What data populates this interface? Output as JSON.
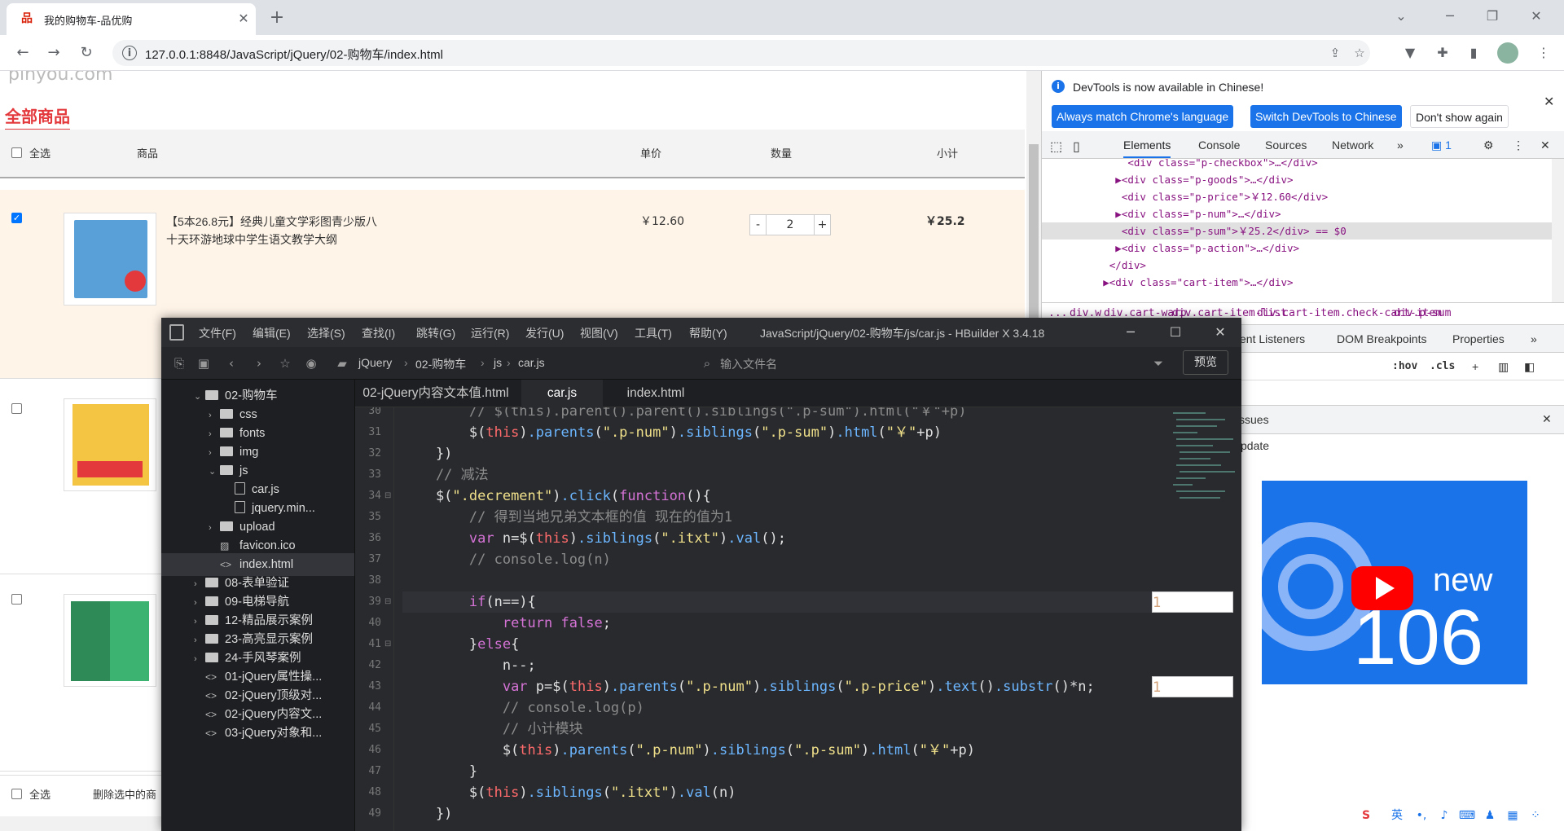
{
  "browser": {
    "tab_title": "我的购物车-品优购",
    "tab_favicon": "cart-icon",
    "url": "127.0.0.1:8848/JavaScript/jQuery/02-购物车/index.html"
  },
  "page": {
    "logo_fragment": "pinyou.com",
    "all_goods": "全部商品",
    "header": {
      "select_all": "全选",
      "goods": "商品",
      "unit_price": "单价",
      "quantity": "数量",
      "subtotal": "小计"
    },
    "items": [
      {
        "title": "【5本26.8元】经典儿童文学彩图青少版八十天环游地球中学生语文教学大纲",
        "price": "￥12.60",
        "qty": "2",
        "sum": "￥25.2",
        "checked": true
      },
      {
        "title": "",
        "price": "",
        "qty": "",
        "sum": "",
        "checked": false
      },
      {
        "title": "",
        "price": "",
        "qty": "",
        "sum": "",
        "checked": false
      }
    ],
    "qty_minus": "-",
    "qty_plus": "+",
    "footer": {
      "select_all": "全选",
      "delete_selected": "删除选中的商"
    }
  },
  "devtools": {
    "banner_msg": "DevTools is now available in Chinese!",
    "btn_match": "Always match Chrome's language",
    "btn_switch": "Switch DevTools to Chinese",
    "btn_dont": "Don't show again",
    "tabs": [
      "Elements",
      "Console",
      "Sources",
      "Network"
    ],
    "issues_count": "1",
    "dom_lines": [
      {
        "pre": "      <div class=\"p-checkbox\">…</div>",
        "sel": false
      },
      {
        "pre": "    ▶<div class=\"p-goods\">…</div>",
        "sel": false
      },
      {
        "pre": "     <div class=\"p-price\">￥12.60</div>",
        "sel": false
      },
      {
        "pre": "    ▶<div class=\"p-num\">…</div>",
        "sel": false
      },
      {
        "pre": "     <div class=\"p-sum\">￥25.2</div> == $0",
        "sel": true
      },
      {
        "pre": "    ▶<div class=\"p-action\">…</div>",
        "sel": false
      },
      {
        "pre": "   </div>",
        "sel": false
      },
      {
        "pre": "  ▶<div class=\"cart-item\">…</div>",
        "sel": false
      }
    ],
    "crumbs": [
      "div.w",
      "div.cart-warp",
      "div.cart-item-list",
      "div.cart-item.check-cart-item",
      "div.p-sum"
    ],
    "subtabs": [
      "vent Listeners",
      "DOM Breakpoints",
      "Properties"
    ],
    "filter_hov": ":hov",
    "filter_cls": ".cls",
    "issues_label": "ssues",
    "update_label": "pdate",
    "promo_new": "new",
    "promo_num": "106"
  },
  "hbuilder": {
    "menu": [
      "文件(F)",
      "编辑(E)",
      "选择(S)",
      "查找(I)",
      "跳转(G)",
      "运行(R)",
      "发行(U)",
      "视图(V)",
      "工具(T)",
      "帮助(Y)"
    ],
    "window_title": "JavaScript/jQuery/02-购物车/js/car.js - HBuilder X 3.4.18",
    "path": [
      "jQuery",
      "02-购物车",
      "js",
      "car.js"
    ],
    "search_placeholder": "输入文件名",
    "preview": "预览",
    "tree": [
      {
        "label": "02-购物车",
        "type": "folder-open",
        "indent": 40
      },
      {
        "label": "css",
        "type": "folder",
        "indent": 58
      },
      {
        "label": "fonts",
        "type": "folder",
        "indent": 58
      },
      {
        "label": "img",
        "type": "folder",
        "indent": 58
      },
      {
        "label": "js",
        "type": "folder-open",
        "indent": 58
      },
      {
        "label": "car.js",
        "type": "file",
        "indent": 90
      },
      {
        "label": "jquery.min...",
        "type": "file",
        "indent": 90
      },
      {
        "label": "upload",
        "type": "folder",
        "indent": 58
      },
      {
        "label": "favicon.ico",
        "type": "image",
        "indent": 72
      },
      {
        "label": "index.html",
        "type": "code",
        "indent": 72,
        "sel": true
      },
      {
        "label": "08-表单验证",
        "type": "folder",
        "indent": 40
      },
      {
        "label": "09-电梯导航",
        "type": "folder",
        "indent": 40
      },
      {
        "label": "12-精品展示案例",
        "type": "folder",
        "indent": 40
      },
      {
        "label": "23-高亮显示案例",
        "type": "folder",
        "indent": 40
      },
      {
        "label": "24-手风琴案例",
        "type": "folder",
        "indent": 40
      },
      {
        "label": "01-jQuery属性操...",
        "type": "code",
        "indent": 54
      },
      {
        "label": "02-jQuery顶级对...",
        "type": "code",
        "indent": 54
      },
      {
        "label": "02-jQuery内容文...",
        "type": "code",
        "indent": 54
      },
      {
        "label": "03-jQuery对象和...",
        "type": "code",
        "indent": 54
      }
    ],
    "tabs": [
      "02-jQuery内容文本值.html",
      "car.js",
      "index.html"
    ],
    "code_lines": [
      {
        "n": "30",
        "text": "        // $(this).parent().parent().siblings(\".p-sum\").html(\"￥\"+p)"
      },
      {
        "n": "31",
        "text": "        $(this).parents(\".p-num\").siblings(\".p-sum\").html(\"￥\"+p)"
      },
      {
        "n": "32",
        "text": "    })"
      },
      {
        "n": "33",
        "text": "    // 减法"
      },
      {
        "n": "34",
        "text": "    $(\".decrement\").click(function(){"
      },
      {
        "n": "35",
        "text": "        // 得到当地兄弟文本框的值 现在的值为1"
      },
      {
        "n": "36",
        "text": "        var n=$(this).siblings(\".itxt\").val();"
      },
      {
        "n": "37",
        "text": "        // console.log(n)"
      },
      {
        "n": "38",
        "text": ""
      },
      {
        "n": "39",
        "text": "        if(n==1){"
      },
      {
        "n": "40",
        "text": "            return false;"
      },
      {
        "n": "41",
        "text": "        }else{"
      },
      {
        "n": "42",
        "text": "            n--;"
      },
      {
        "n": "43",
        "text": "            var p=$(this).parents(\".p-num\").siblings(\".p-price\").text().substr(1)*n;"
      },
      {
        "n": "44",
        "text": "            // console.log(p)"
      },
      {
        "n": "45",
        "text": "            // 小计模块"
      },
      {
        "n": "46",
        "text": "            $(this).parents(\".p-num\").siblings(\".p-sum\").html(\"￥\"+p)"
      },
      {
        "n": "47",
        "text": "        }"
      },
      {
        "n": "48",
        "text": "        $(this).siblings(\".itxt\").val(n)"
      },
      {
        "n": "49",
        "text": "    })"
      }
    ]
  },
  "taskbar": {
    "ime": "英"
  }
}
